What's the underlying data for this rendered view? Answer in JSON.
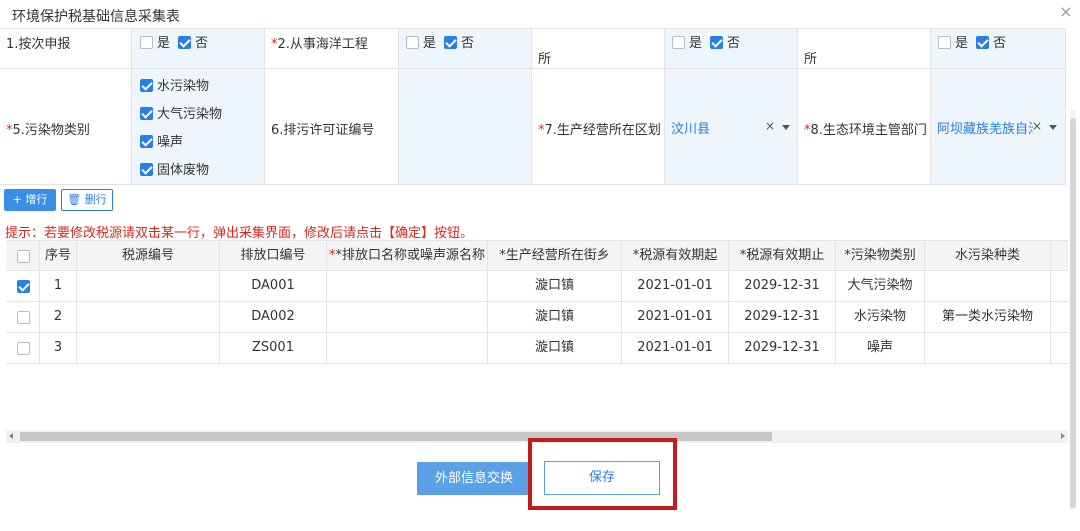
{
  "dialog": {
    "title": "环境保护税基础信息采集表",
    "close_glyph": "×"
  },
  "form": {
    "row1": {
      "label1": "1.按次申报",
      "yes": "是",
      "no": "否",
      "label2_req": "*",
      "label2": "2.从事海洋工程",
      "label3": "所",
      "label4": "所"
    },
    "row2": {
      "pollutant_label_req": "*",
      "pollutant_label": "5.污染物类别",
      "pollutants": [
        "水污染物",
        "大气污染物",
        "噪声",
        "固体废物"
      ],
      "permit_label": "6.排污许可证编号",
      "permit_value": "",
      "district_label_req": "*",
      "district_label": "7.生产经营所在区划",
      "district_value": "汶川县",
      "authority_label_req": "*",
      "authority_label": "8.生态环境主管部门",
      "authority_value": "阿坝藏族羌族自治",
      "clear_glyph": "×"
    }
  },
  "toolbar": {
    "add_label": "+ 增行",
    "delete_label": "🗑 删行"
  },
  "hint": "提示：若要修改税源请双击某一行，弹出采集界面，修改后请点击【确定】按钮。",
  "table": {
    "columns": [
      "序号",
      "税源编号",
      "排放口编号",
      "*排放口名称或噪声源名称",
      "*生产经营所在街乡",
      "*税源有效期起",
      "*税源有效期止",
      "*污染物类别",
      "水污染种类"
    ],
    "rows": [
      {
        "checked": true,
        "cells": [
          "1",
          "",
          "DA001",
          "",
          "漩口镇",
          "2021-01-01",
          "2029-12-31",
          "大气污染物",
          ""
        ]
      },
      {
        "checked": false,
        "cells": [
          "2",
          "",
          "DA002",
          "",
          "漩口镇",
          "2021-01-01",
          "2029-12-31",
          "水污染物",
          "第一类水污染物"
        ]
      },
      {
        "checked": false,
        "cells": [
          "3",
          "",
          "ZS001",
          "",
          "漩口镇",
          "2021-01-01",
          "2029-12-31",
          "噪声",
          ""
        ]
      }
    ]
  },
  "footer": {
    "exchange_label": "外部信息交换",
    "save_label": "保存"
  },
  "colors": {
    "primary": "#2a7ee8",
    "required": "#e0271a",
    "highlight": "#c41a1a"
  }
}
